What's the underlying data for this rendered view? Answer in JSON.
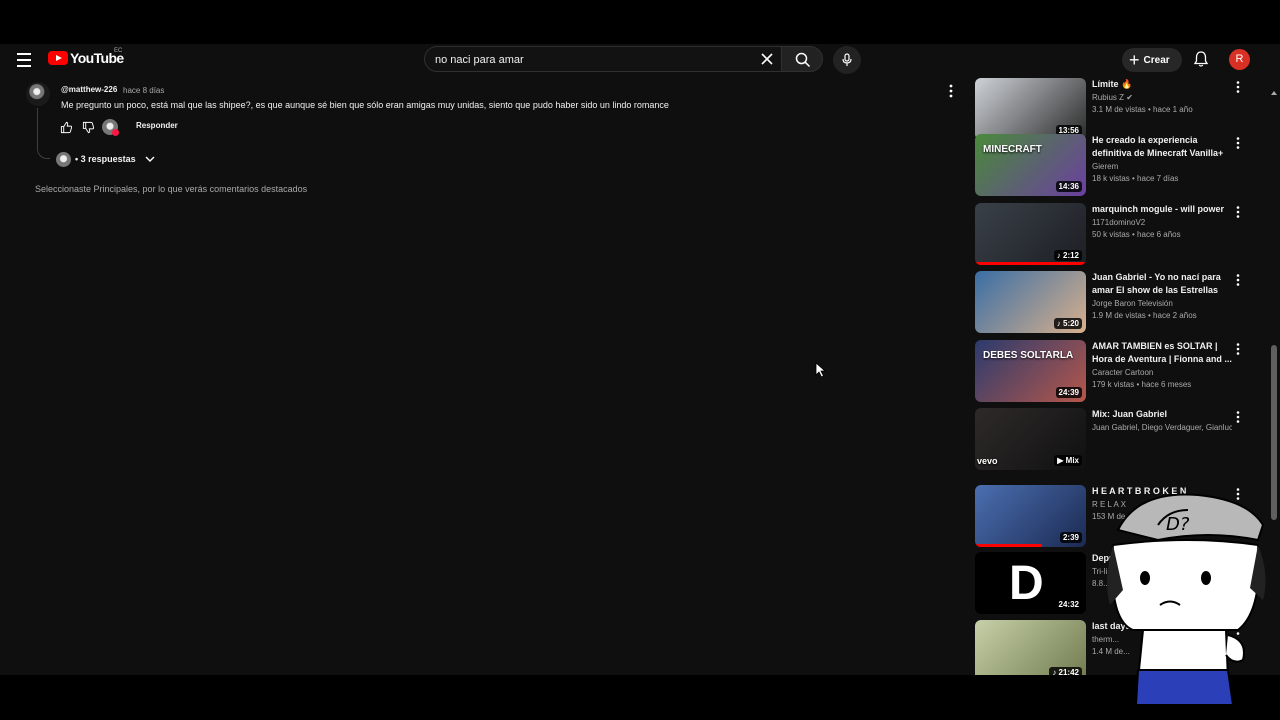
{
  "masthead": {
    "logo_text": "YouTube",
    "country_code": "EC",
    "search_value": "no naci para amar",
    "create_label": "Crear",
    "avatar_letter": "R",
    "accent_color": "#ff0000"
  },
  "comment": {
    "author": "@matthew-226",
    "time": "hace 8 días",
    "text": "Me pregunto un poco, está mal que las shipee?, es que aunque sé bien que sólo eran amigas muy unidas, siento que pudo haber sido un lindo romance",
    "reply_label": "Responder",
    "replies_label": "• 3 respuestas"
  },
  "sort_note": "Seleccionaste Principales, por lo que verás comentarios destacados",
  "sidebar": {
    "videos": [
      {
        "title": "Límite 🔥",
        "channel": "Rubius Z ✔",
        "meta": "3.1 M de vistas • hace 1 año",
        "duration": "13:56",
        "thumb_colors": [
          "#cfd3d8",
          "#2a2a2a"
        ]
      },
      {
        "title": "He creado la experiencia definitiva de Minecraft Vanilla+",
        "channel": "Gierem",
        "meta": "18 k vistas • hace 7 días",
        "duration": "14:36",
        "thumb_text": "MINECRAFT",
        "thumb_colors": [
          "#4a8a3a",
          "#6b3fa0"
        ]
      },
      {
        "title": "marquinch mogule - will power",
        "channel": "1171dominoV2",
        "meta": "50 k vistas • hace 6 años",
        "duration": "♪ 2:12",
        "thumb_colors": [
          "#3a4048",
          "#1c1f24"
        ],
        "progress": 1.0
      },
      {
        "title": "Juan Gabriel - Yo no nací para amar El show de las Estrellas",
        "channel": "Jorge Baron Televisión",
        "meta": "1.9 M de vistas • hace 2 años",
        "duration": "♪ 5:20",
        "thumb_colors": [
          "#3a6ea5",
          "#d8b08c"
        ]
      },
      {
        "title": "AMAR TAMBIEN es SOLTAR | Hora de Aventura | Fionna and ...",
        "channel": "Caracter Cartoon",
        "meta": "179 k vistas • hace 6 meses",
        "duration": "24:39",
        "thumb_text": "DEBES SOLTARLA",
        "thumb_colors": [
          "#2b3b6e",
          "#b5574a"
        ]
      },
      {
        "title": "Mix: Juan Gabriel",
        "channel": "Juan Gabriel, Diego Verdaguer, Gianluca ...",
        "meta": "",
        "duration": "▶ Mix",
        "thumb_text": "vevo",
        "thumb_colors": [
          "#2e2a2a",
          "#101010"
        ]
      },
      {
        "title": "H E A R T B R O K E N",
        "channel": "R E L A X",
        "meta": "153 M de v...",
        "duration": "2:39",
        "thumb_colors": [
          "#4b6fb0",
          "#1b2a52"
        ],
        "progress": 0.6
      },
      {
        "title": "Depre...",
        "channel": "Tri-li...",
        "meta": "8.8...",
        "duration": "24:32",
        "thumb_text": "D",
        "thumb_colors": [
          "#000000",
          "#000000"
        ]
      },
      {
        "title": "last days",
        "channel": "therm...",
        "meta": "1.4 M de...",
        "duration": "♪ 21:42",
        "thumb_colors": [
          "#c7d0a8",
          "#6f7a4e"
        ]
      }
    ]
  },
  "icons": {
    "menu": "menu-icon",
    "search": "search-icon",
    "clear": "close-icon",
    "mic": "mic-icon",
    "bell": "bell-icon",
    "more": "more-vert-icon",
    "like": "thumb-up-icon",
    "dislike": "thumb-down-icon",
    "chevron": "chevron-down-icon",
    "cursor": "mouse-cursor-icon"
  }
}
